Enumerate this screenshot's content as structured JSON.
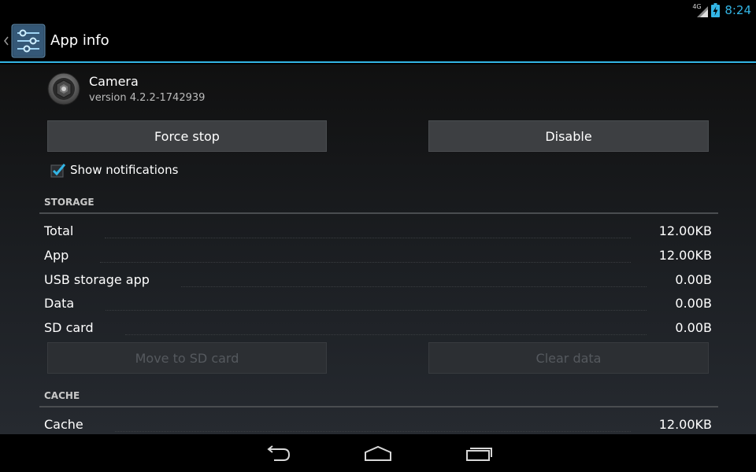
{
  "status_bar": {
    "network": "4G",
    "time": "8:24",
    "accent_color": "#33b5e5"
  },
  "action_bar": {
    "title": "App info",
    "icon": "settings-sliders-icon"
  },
  "app": {
    "name": "Camera",
    "version": "version 4.2.2-1742939",
    "icon": "camera-icon"
  },
  "buttons": {
    "force_stop": "Force stop",
    "disable": "Disable",
    "move_to_sd": "Move to SD card",
    "clear_data": "Clear data"
  },
  "notifications": {
    "label": "Show notifications",
    "checked": true
  },
  "storage": {
    "header": "STORAGE",
    "rows": [
      {
        "label": "Total",
        "value": "12.00KB"
      },
      {
        "label": "App",
        "value": "12.00KB"
      },
      {
        "label": "USB storage app",
        "value": "0.00B"
      },
      {
        "label": "Data",
        "value": "0.00B"
      },
      {
        "label": "SD card",
        "value": "0.00B"
      }
    ]
  },
  "cache": {
    "header": "CACHE",
    "rows": [
      {
        "label": "Cache",
        "value": "12.00KB"
      }
    ]
  },
  "nav_bar": {
    "back": "back-icon",
    "home": "home-icon",
    "recents": "recent-apps-icon"
  }
}
